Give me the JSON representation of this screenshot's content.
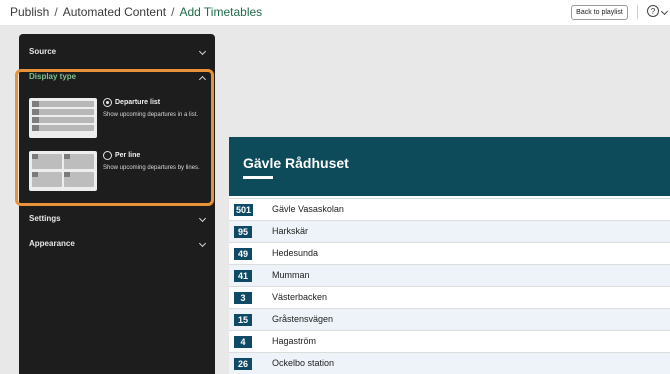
{
  "breadcrumb": {
    "items": [
      "Publish",
      "Automated Content",
      "Add Timetables"
    ],
    "separator": "/"
  },
  "header": {
    "back_label": "Back to playlist",
    "help_symbol": "?"
  },
  "panel": {
    "sections": {
      "source": "Source",
      "display_type": "Display type",
      "settings": "Settings",
      "appearance": "Appearance"
    },
    "options": [
      {
        "title": "Departure list",
        "description": "Show upcoming departures in a list.",
        "selected": true
      },
      {
        "title": "Per line",
        "description": "Show upcoming departures by lines.",
        "selected": false
      }
    ]
  },
  "timetable": {
    "stop_name": "Gävle Rådhuset",
    "rows": [
      {
        "line": "501",
        "destination": "Gävle Vasaskolan"
      },
      {
        "line": "95",
        "destination": "Harkskär"
      },
      {
        "line": "49",
        "destination": "Hedesunda"
      },
      {
        "line": "41",
        "destination": "Mumman"
      },
      {
        "line": "3",
        "destination": "Västerbacken"
      },
      {
        "line": "15",
        "destination": "Gråstensvägen"
      },
      {
        "line": "4",
        "destination": "Hagaström"
      },
      {
        "line": "26",
        "destination": "Ockelbo station"
      }
    ]
  },
  "colors": {
    "accent_green": "#7fc08e",
    "highlight_orange": "#e8923a",
    "timetable_header": "#0d4a5a",
    "line_badge": "#0e4a66"
  }
}
